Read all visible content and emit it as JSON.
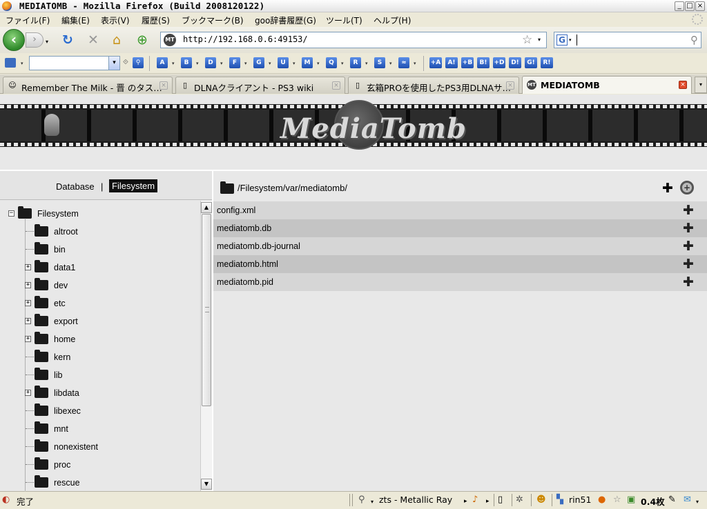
{
  "window": {
    "title": "MEDIATOMB - Mozilla Firefox (Build 2008120122)",
    "controls": {
      "minimize": "_",
      "maximize": "□",
      "close": "×"
    }
  },
  "menubar": {
    "items": [
      "ファイル(F)",
      "編集(E)",
      "表示(V)",
      "履歴(S)",
      "ブックマーク(B)",
      "goo辞書履歴(G)",
      "ツール(T)",
      "ヘルプ(H)"
    ]
  },
  "navbar": {
    "back": "‹",
    "forward": "›",
    "dropdown": "▾",
    "reload": "↻",
    "stop": "✕",
    "home": "⌂",
    "new_tab": "⊕",
    "site_icon": "MT",
    "url": "http://192.168.0.6:49153/",
    "star": "☆",
    "search_engine": "G",
    "search_value": "",
    "search_icon": "⚲"
  },
  "toolbar2": {
    "select_value": "",
    "select_arrow": "▾",
    "buttons": [
      "A",
      "B",
      "D",
      "F",
      "G",
      "U",
      "M",
      "Q",
      "R",
      "S",
      "≈"
    ],
    "right_buttons": [
      "+A",
      "A!",
      "+B",
      "B!",
      "+D",
      "D!",
      "G!",
      "R!"
    ],
    "drop": "▾"
  },
  "tabs": [
    {
      "favicon": "☺",
      "label": "Remember The Milk - 晋 のタス…",
      "active": false
    },
    {
      "favicon": "▯",
      "label": "DLNAクライアント - PS3 wiki",
      "active": false
    },
    {
      "favicon": "▯",
      "label": "玄箱PROを使用したPS3用DLNAサ…",
      "active": false
    },
    {
      "favicon": "MT",
      "label": "MEDIATOMB",
      "active": true
    }
  ],
  "tab_close": "×",
  "tab_list": "▾",
  "page": {
    "logo": "MediaTomb",
    "nav": {
      "database": "Database",
      "separator": "|",
      "filesystem": "Filesystem"
    },
    "tree": {
      "root": "Filesystem",
      "items": [
        {
          "name": "altroot",
          "expandable": false
        },
        {
          "name": "bin",
          "expandable": false
        },
        {
          "name": "data1",
          "expandable": true
        },
        {
          "name": "dev",
          "expandable": true
        },
        {
          "name": "etc",
          "expandable": true
        },
        {
          "name": "export",
          "expandable": true
        },
        {
          "name": "home",
          "expandable": true
        },
        {
          "name": "kern",
          "expandable": false
        },
        {
          "name": "lib",
          "expandable": false
        },
        {
          "name": "libdata",
          "expandable": true
        },
        {
          "name": "libexec",
          "expandable": false
        },
        {
          "name": "mnt",
          "expandable": false
        },
        {
          "name": "nonexistent",
          "expandable": false
        },
        {
          "name": "proc",
          "expandable": false
        },
        {
          "name": "rescue",
          "expandable": false
        }
      ],
      "expand_symbol": "+",
      "collapse_symbol": "−"
    },
    "path": "/Filesystem/var/mediatomb/",
    "add_symbol": "✚",
    "gear_symbol": "+",
    "files": [
      "config.xml",
      "mediatomb.db",
      "mediatomb.db-journal",
      "mediatomb.html",
      "mediatomb.pid"
    ],
    "scroll": {
      "up": "▲",
      "down": "▼"
    }
  },
  "statusbar": {
    "status": "完了",
    "theme": "zts - Metallic Ray",
    "user": "rin51",
    "rating": "0.4枚"
  }
}
